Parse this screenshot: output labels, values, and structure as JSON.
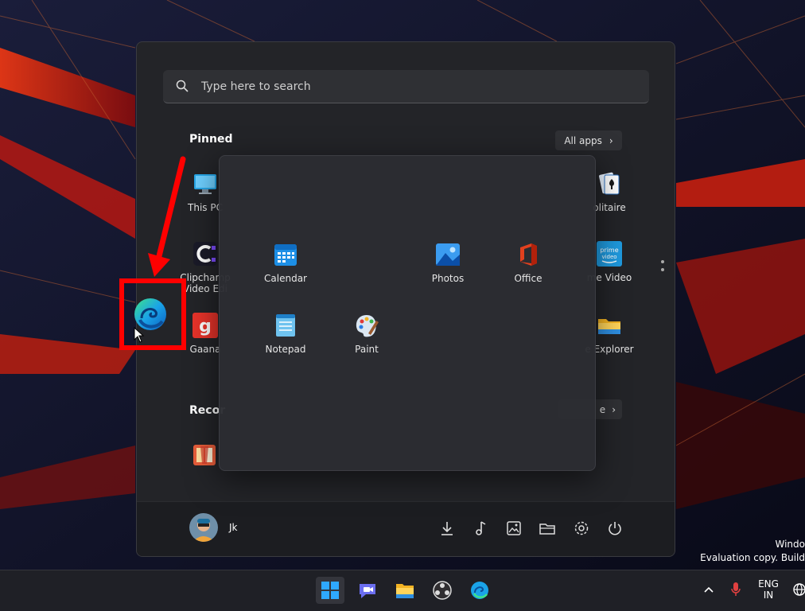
{
  "search": {
    "placeholder": "Type here to search",
    "icon": "search-icon"
  },
  "pinned": {
    "title": "Pinned",
    "all_apps_label": "All apps",
    "apps": [
      {
        "label": "This PC",
        "icon": "monitor-icon"
      },
      {
        "label": "Clipchamp - Video Editor",
        "icon": "clipchamp-icon"
      },
      {
        "label": "Gaana",
        "icon": "gaana-icon"
      },
      {
        "label": "Solitaire",
        "icon": "solitaire-icon"
      },
      {
        "label": "Prime Video",
        "icon": "prime-video-icon"
      },
      {
        "label": "File Explorer",
        "icon": "folder-icon"
      }
    ],
    "visible_labels": {
      "this_pc": "This PC",
      "clipchamp_line1": "Clipchamp",
      "clipchamp_line2": "Video Edi",
      "gaana": "Gaana",
      "solitaire": "olitaire",
      "prime": "me Video",
      "explorer": "e Explorer"
    }
  },
  "folder": {
    "apps": [
      {
        "label": "Calendar",
        "icon": "calendar-icon"
      },
      {
        "label": "Photos",
        "icon": "photos-icon"
      },
      {
        "label": "Office",
        "icon": "office-icon"
      },
      {
        "label": "Notepad",
        "icon": "notepad-icon"
      },
      {
        "label": "Paint",
        "icon": "paint-icon"
      }
    ]
  },
  "recommended": {
    "title_visible": "Recor",
    "more_visible": "e"
  },
  "footer": {
    "user_name": "Jk"
  },
  "tray": {
    "lang_line1": "ENG",
    "lang_line2": "IN"
  },
  "watermark": {
    "line1": "Windo",
    "line2": "Evaluation copy. Build"
  },
  "colors": {
    "highlight": "#ff0000",
    "accent": "#0a84ff",
    "start_bg": "#232428",
    "taskbar_bg": "#1f2026"
  }
}
